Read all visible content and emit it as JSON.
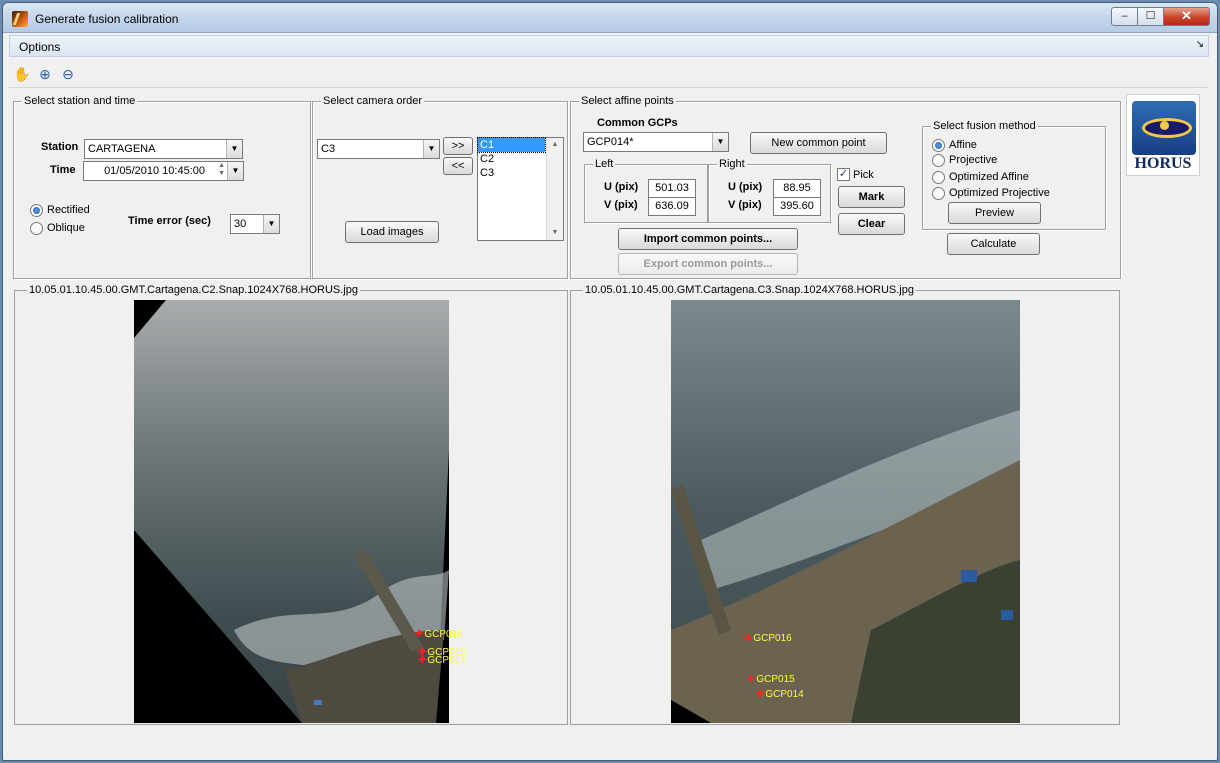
{
  "window": {
    "title": "Generate fusion calibration",
    "min_glyph": "–",
    "max_glyph": "☐",
    "close_glyph": "✕"
  },
  "menu": {
    "options": "Options",
    "arrow": "↘"
  },
  "toolbar": {
    "pan_icon": "hand-icon",
    "zoom_in_icon": "zoom-in-icon",
    "zoom_out_icon": "zoom-out-icon"
  },
  "station_time": {
    "legend": "Select station and time",
    "station_label": "Station",
    "station_value": "CARTAGENA",
    "time_label": "Time",
    "time_value": "01/05/2010 10:45:00",
    "rectified_label": "Rectified",
    "oblique_label": "Oblique",
    "selected_mode": "Rectified",
    "time_error_label": "Time error (sec)",
    "time_error_value": "30"
  },
  "camera_order": {
    "legend": "Select camera order",
    "camera_value": "C3",
    "add_button": ">>",
    "remove_button": "<<",
    "list": [
      "C1",
      "C2",
      "C3"
    ],
    "selected": "C1",
    "load_button": "Load images"
  },
  "affine_points": {
    "legend": "Select affine points",
    "common_gcps_label": "Common GCPs",
    "gcp_value": "GCP014*",
    "new_point_button": "New common point",
    "left_label": "Left",
    "right_label": "Right",
    "u_label": "U (pix)",
    "v_label": "V (pix)",
    "left_u": "501.03",
    "left_v": "636.09",
    "right_u": "88.95",
    "right_v": "395.60",
    "pick_label": "Pick",
    "pick_checked": true,
    "mark_button": "Mark",
    "clear_button": "Clear",
    "import_button": "Import common points...",
    "export_button": "Export common points..."
  },
  "fusion_method": {
    "legend": "Select fusion method",
    "options": [
      "Affine",
      "Projective",
      "Optimized Affine",
      "Optimized Projective"
    ],
    "selected": "Affine",
    "preview_button": "Preview",
    "calculate_button": "Calculate"
  },
  "logo": {
    "text": "HORUS"
  },
  "left_image": {
    "caption": "10.05.01.10.45.00.GMT.Cartagena.C2.Snap.1024X768.HORUS.jpg",
    "gcps": [
      "GCP016",
      "GCP015",
      "GCP014"
    ]
  },
  "right_image": {
    "caption": "10.05.01.10.45.00.GMT.Cartagena.C3.Snap.1024X768.HORUS.jpg",
    "gcps": [
      "GCP016",
      "GCP015",
      "GCP014"
    ]
  },
  "colors": {
    "gcp_label": "#ffff33",
    "gcp_marker": "#ff2020",
    "selection": "#3399ff"
  }
}
